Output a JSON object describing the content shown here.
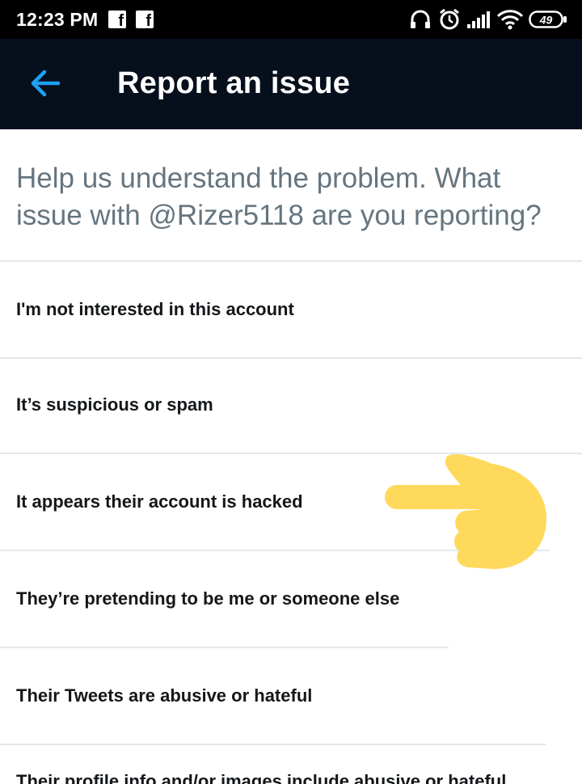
{
  "status_bar": {
    "time": "12:23 PM",
    "notification_icons": [
      "facebook-icon",
      "facebook-icon"
    ],
    "system_icons": [
      "headphones-icon",
      "alarm-icon",
      "signal-icon",
      "wifi-icon",
      "battery-icon"
    ],
    "battery_level": "49"
  },
  "app_bar": {
    "back_icon": "arrow-left-icon",
    "title": "Report an issue",
    "accent_color": "#1da1f2",
    "background_color": "#06101c"
  },
  "prompt": {
    "text": "Help us understand the problem. What issue with @Rizer5118 are you reporting?"
  },
  "options": [
    {
      "label": "I'm not interested in this account"
    },
    {
      "label": "It’s suspicious or spam"
    },
    {
      "label": "It appears their account is hacked"
    },
    {
      "label": "They’re pretending to be me or someone else"
    },
    {
      "label": "Their Tweets are abusive or hateful"
    },
    {
      "label": "Their profile info and/or images include abusive or hateful"
    }
  ],
  "annotation": {
    "icon": "pointing-hand-icon",
    "color": "#ffd95c"
  }
}
